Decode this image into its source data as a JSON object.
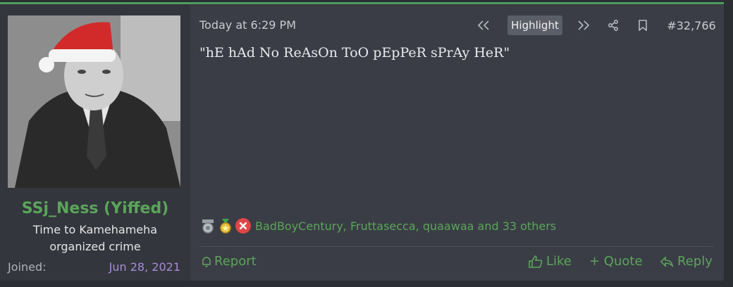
{
  "user": {
    "name": "SSj_Ness (Yiffed)",
    "title_line1": "Time to Kamehameha",
    "title_line2": "organized crime",
    "joined_label": "Joined:",
    "joined_date": "Jun 28, 2021"
  },
  "post": {
    "timestamp": "Today at 6:29 PM",
    "highlight_label": "Highlight",
    "number": "#32,766",
    "body": "\"hE hAd No ReAsOn ToO pEpPeR sPrAy HeR\""
  },
  "reactions": {
    "icons": [
      "gear-medal-icon",
      "gold-medal-icon",
      "red-x-icon"
    ],
    "names": "BadBoyCentury, Fruttasecca, quaawaa and 33 others"
  },
  "actions": {
    "report": "Report",
    "like": "Like",
    "quote": "+ Quote",
    "reply": "Reply"
  },
  "colors": {
    "accent_green": "#5ba55a",
    "date_purple": "#a98bd8",
    "panel_bg": "#3a3d45"
  }
}
